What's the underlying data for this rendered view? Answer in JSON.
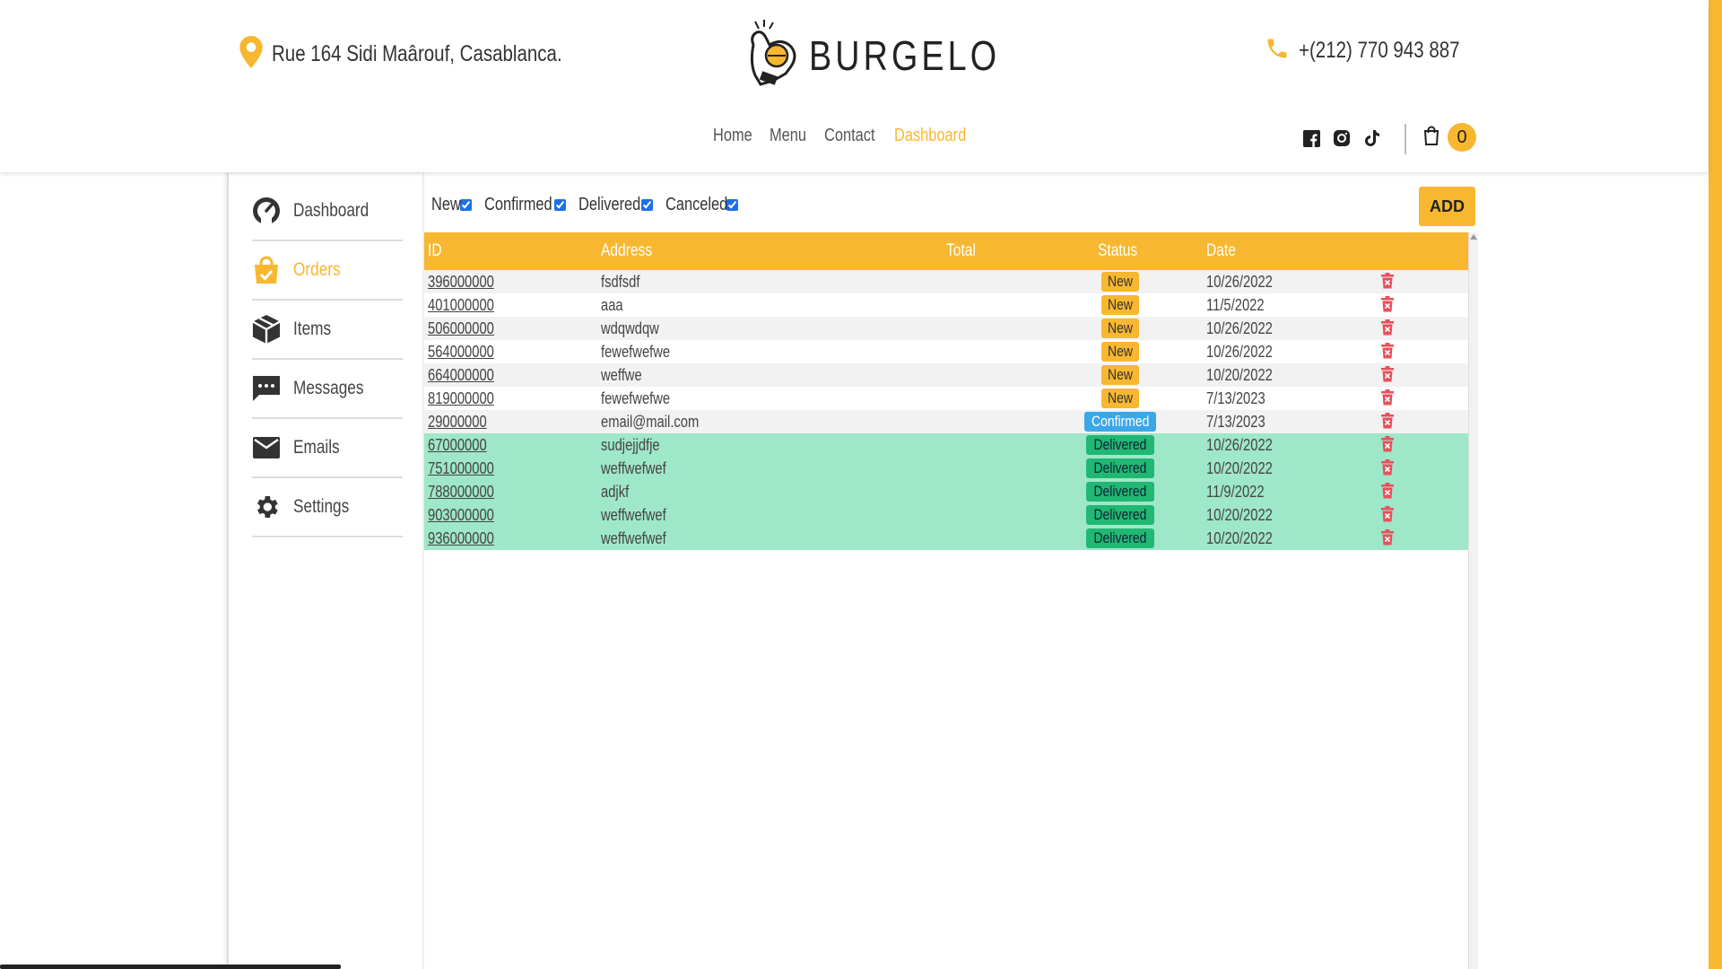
{
  "header": {
    "address": "Rue 164 Sidi Maârouf, Casablanca.",
    "logo_text": "BURGELO",
    "phone": "+(212) 770 943 887",
    "nav": [
      {
        "label": "Home",
        "active": false
      },
      {
        "label": "Menu",
        "active": false
      },
      {
        "label": "Contact",
        "active": false
      },
      {
        "label": "Dashboard",
        "active": true
      }
    ],
    "social_icons": [
      "facebook-icon",
      "instagram-icon",
      "tiktok-icon"
    ],
    "cart_count": "0"
  },
  "sidebar": {
    "items": [
      {
        "label": "Dashboard",
        "icon": "speedometer-icon",
        "active": false
      },
      {
        "label": "Orders",
        "icon": "shopping-bag-icon",
        "active": true
      },
      {
        "label": "Items",
        "icon": "box-icon",
        "active": false
      },
      {
        "label": "Messages",
        "icon": "chat-icon",
        "active": false
      },
      {
        "label": "Emails",
        "icon": "mail-icon",
        "active": false
      },
      {
        "label": "Settings",
        "icon": "gear-icon",
        "active": false
      }
    ]
  },
  "filters": [
    {
      "label": "New",
      "checked": true
    },
    {
      "label": "Confirmed",
      "checked": true
    },
    {
      "label": "Delivered",
      "checked": true
    },
    {
      "label": "Canceled",
      "checked": true
    }
  ],
  "add_label": "ADD",
  "table": {
    "headers": {
      "id": "ID",
      "address": "Address",
      "total": "Total",
      "status": "Status",
      "date": "Date"
    },
    "rows": [
      {
        "id": "396000000",
        "address": "fsdfsdf",
        "total": "",
        "status": "New",
        "date": "10/26/2022"
      },
      {
        "id": "401000000",
        "address": "aaa",
        "total": "",
        "status": "New",
        "date": "11/5/2022"
      },
      {
        "id": "506000000",
        "address": "wdqwdqw",
        "total": "",
        "status": "New",
        "date": "10/26/2022"
      },
      {
        "id": "564000000",
        "address": "fewefwefwe",
        "total": "",
        "status": "New",
        "date": "10/26/2022"
      },
      {
        "id": "664000000",
        "address": "weffwe",
        "total": "",
        "status": "New",
        "date": "10/20/2022"
      },
      {
        "id": "819000000",
        "address": "fewefwefwe",
        "total": "",
        "status": "New",
        "date": "7/13/2023"
      },
      {
        "id": "29000000",
        "address": "email@mail.com",
        "total": "",
        "status": "Confirmed",
        "date": "7/13/2023"
      },
      {
        "id": "67000000",
        "address": "sudjejjdfje",
        "total": "",
        "status": "Delivered",
        "date": "10/26/2022"
      },
      {
        "id": "751000000",
        "address": "weffwefwef",
        "total": "",
        "status": "Delivered",
        "date": "10/20/2022"
      },
      {
        "id": "788000000",
        "address": "adjkf",
        "total": "",
        "status": "Delivered",
        "date": "11/9/2022"
      },
      {
        "id": "903000000",
        "address": "weffwefwef",
        "total": "",
        "status": "Delivered",
        "date": "10/20/2022"
      },
      {
        "id": "936000000",
        "address": "weffwefwef",
        "total": "",
        "status": "Delivered",
        "date": "10/20/2022"
      }
    ]
  },
  "colors": {
    "accent": "#f7b731",
    "delivered_row": "#9fe7c9",
    "confirmed": "#3aa8e8",
    "delivered_badge": "#20b873",
    "delete": "#e8505b"
  }
}
